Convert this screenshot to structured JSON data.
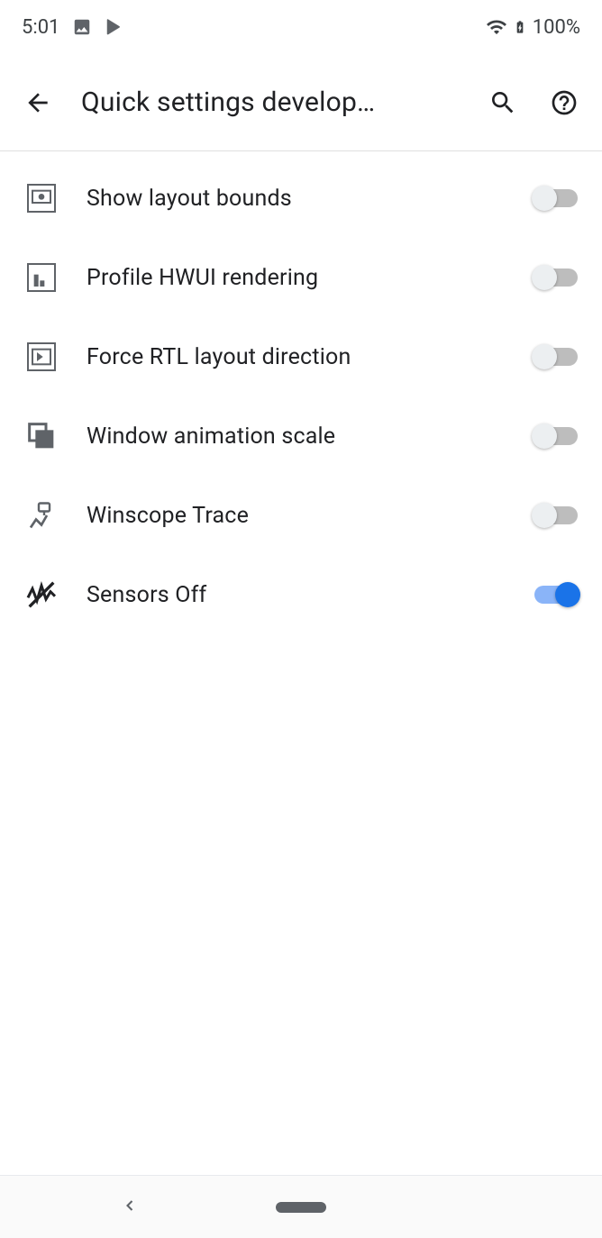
{
  "statusbar": {
    "time": "5:01",
    "battery": "100%"
  },
  "appbar": {
    "title": "Quick settings develop…"
  },
  "items": [
    {
      "label": "Show layout bounds",
      "on": false
    },
    {
      "label": "Profile HWUI rendering",
      "on": false
    },
    {
      "label": "Force RTL layout direction",
      "on": false
    },
    {
      "label": "Window animation scale",
      "on": false
    },
    {
      "label": "Winscope Trace",
      "on": false
    },
    {
      "label": "Sensors Off",
      "on": true
    }
  ]
}
